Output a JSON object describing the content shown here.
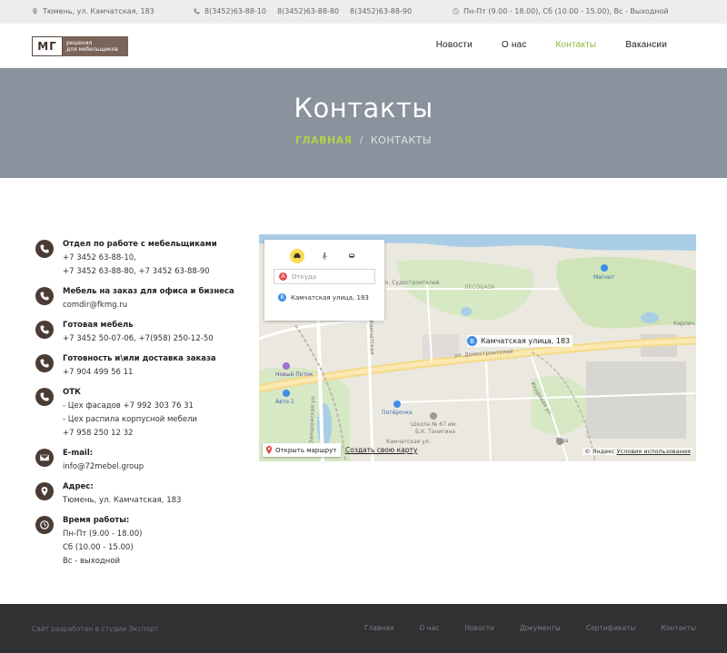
{
  "topbar": {
    "address": "Тюмень, ул. Камчатская, 183",
    "phones": [
      "8(3452)63-88-10",
      "8(3452)63-88-80",
      "8(3452)63-88-90"
    ],
    "hours": "Пн-Пт (9.00 - 18.00), Сб (10.00 - 15.00), Вс - Выходной"
  },
  "logo": {
    "mark": "МГ",
    "line1": "решения",
    "line2": "для мебельщиков"
  },
  "nav": [
    {
      "label": "Новости",
      "active": false
    },
    {
      "label": "О нас",
      "active": false
    },
    {
      "label": "Контакты",
      "active": true
    },
    {
      "label": "Вакансии",
      "active": false
    }
  ],
  "hero": {
    "title": "Контакты",
    "crumb_home": "ГЛАВНАЯ",
    "crumb_sep": "/",
    "crumb_current": "КОНТАКТЫ"
  },
  "contacts": [
    {
      "icon": "phone-icon",
      "title": "Отдел по работе с мебельщиками",
      "lines": [
        "+7 3452 63-88-10,",
        "+7 3452 63-88-80, +7 3452 63-88-90"
      ]
    },
    {
      "icon": "phone-icon",
      "title": "Мебель на заказ для офиса и бизнеса",
      "lines": [
        "comdir@fkmg.ru"
      ]
    },
    {
      "icon": "phone-icon",
      "title": "Готовая мебель",
      "lines": [
        "+7 3452 50-07-06, +7(958) 250-12-50"
      ]
    },
    {
      "icon": "phone-icon",
      "title": "Готовность и\\или доставка заказа",
      "lines": [
        "+7 904 499 56 11"
      ]
    },
    {
      "icon": "phone-icon",
      "title": "ОТК",
      "lines": [
        "- Цех фасадов +7 992 303 76 31",
        "- Цех распила корпусной мебели",
        "+7 958 250 12 32"
      ]
    },
    {
      "icon": "mail-icon",
      "title": "E-mail:",
      "lines": [
        "info@72mebel.group"
      ]
    },
    {
      "icon": "location-icon",
      "title": "Адрес:",
      "lines": [
        "Тюмень, ул. Камчатская, 183"
      ]
    },
    {
      "icon": "clock-icon",
      "title": "Время работы:",
      "lines": [
        "Пн-Пт  (9.00 - 18.00)",
        "Сб  (10.00 - 15.00)",
        "Вс - выходной"
      ]
    }
  ],
  "map": {
    "from_placeholder": "Откуда",
    "from_pin": "A",
    "to_value": "Камчатская улица, 183",
    "to_pin": "B",
    "pin_label": "Камчатская улица, 183",
    "open_route": "Открыть маршрут",
    "create_map": "Создать свою карту",
    "copyright": "© Яндекс",
    "terms": "Условия использования",
    "labels": {
      "sudostroiteley": "ул. Судостроителей",
      "lesobaza": "ЛЕСОБАЗА",
      "magnit": "Магнит",
      "kirpich": "Кирпич",
      "domostroiteley": "ул. Домостроителей",
      "novy_potok": "Новый Поток",
      "auto1": "Авто-1",
      "pyaterochka": "Пятёрочка",
      "school": "Школа № 67 им.",
      "school2": "Б.К. Танигина",
      "kamchatskaya": "Камчатская ул.",
      "kedrovaya": "Кедровая ул.",
      "tura": "Тура",
      "zaporozhskaya": "Запорожская ул.",
      "kamchatskaya_v": "Камчатская"
    }
  },
  "footer": {
    "credit": "Сайт разработан в студии Экспорт",
    "links": [
      "Главная",
      "О нас",
      "Новости",
      "Документы",
      "Сертификаты",
      "Контакты"
    ]
  }
}
